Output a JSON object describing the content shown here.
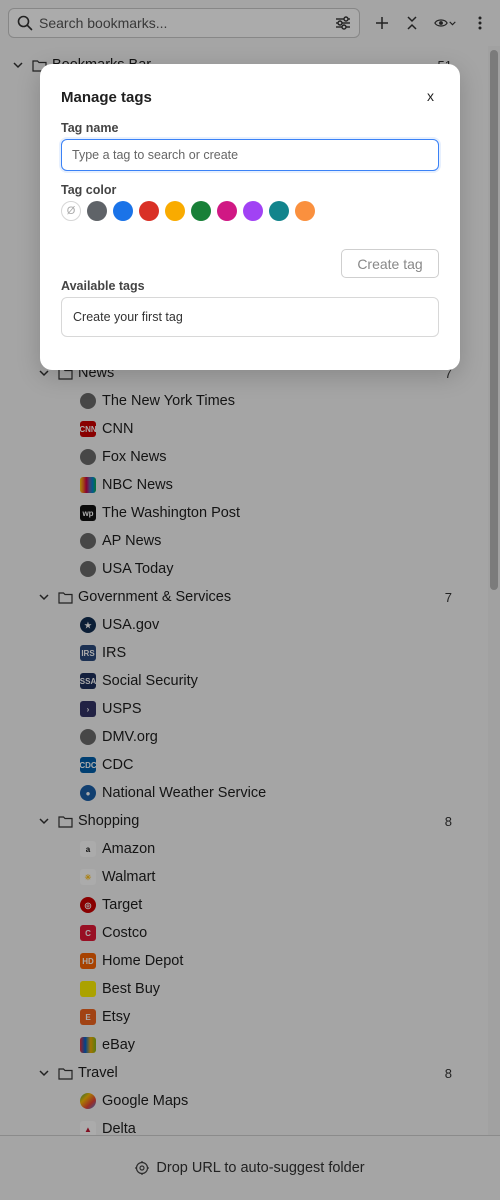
{
  "toolbar": {
    "search_placeholder": "Search bookmarks...",
    "icons": [
      "search-icon",
      "filter-sliders-icon",
      "plus-icon",
      "collapse-icon",
      "eye-icon",
      "chevron-down-icon",
      "more-vertical-icon"
    ]
  },
  "tree": {
    "root": {
      "label": "Bookmarks Bar",
      "count": "51"
    },
    "folders": [
      {
        "label": "News",
        "count": "7",
        "items": [
          {
            "label": "The New York Times",
            "icon": "globe-icon"
          },
          {
            "label": "CNN",
            "icon": "cnn-icon"
          },
          {
            "label": "Fox News",
            "icon": "globe-icon"
          },
          {
            "label": "NBC News",
            "icon": "nbc-peacock-icon"
          },
          {
            "label": "The Washington Post",
            "icon": "wapo-icon"
          },
          {
            "label": "AP News",
            "icon": "globe-icon"
          },
          {
            "label": "USA Today",
            "icon": "globe-icon"
          }
        ]
      },
      {
        "label": "Government & Services",
        "count": "7",
        "items": [
          {
            "label": "USA.gov",
            "icon": "usagov-icon"
          },
          {
            "label": "IRS",
            "icon": "irs-icon"
          },
          {
            "label": "Social Security",
            "icon": "ssa-icon"
          },
          {
            "label": "USPS",
            "icon": "usps-icon"
          },
          {
            "label": "DMV.org",
            "icon": "globe-icon"
          },
          {
            "label": "CDC",
            "icon": "cdc-icon"
          },
          {
            "label": "National Weather Service",
            "icon": "nws-icon"
          }
        ]
      },
      {
        "label": "Shopping",
        "count": "8",
        "items": [
          {
            "label": "Amazon",
            "icon": "amazon-icon"
          },
          {
            "label": "Walmart",
            "icon": "walmart-icon"
          },
          {
            "label": "Target",
            "icon": "target-icon"
          },
          {
            "label": "Costco",
            "icon": "costco-icon"
          },
          {
            "label": "Home Depot",
            "icon": "home-depot-icon"
          },
          {
            "label": "Best Buy",
            "icon": "best-buy-icon"
          },
          {
            "label": "Etsy",
            "icon": "etsy-icon"
          },
          {
            "label": "eBay",
            "icon": "ebay-icon"
          }
        ]
      },
      {
        "label": "Travel",
        "count": "8",
        "items": [
          {
            "label": "Google Maps",
            "icon": "google-maps-icon"
          },
          {
            "label": "Delta",
            "icon": "delta-icon"
          }
        ]
      }
    ]
  },
  "footer": {
    "label": "Drop URL to auto-suggest folder",
    "icon": "target-crosshair-icon"
  },
  "modal": {
    "title": "Manage tags",
    "close_label": "x",
    "tag_name_label": "Tag name",
    "tag_name_placeholder": "Type a tag to search or create",
    "tag_name_value": "",
    "tag_color_label": "Tag color",
    "no_color_glyph": "Ø",
    "colors": [
      "#5f6368",
      "#1a73e8",
      "#d93025",
      "#f9ab00",
      "#188038",
      "#d01884",
      "#a142f4",
      "#12848c",
      "#fa903e"
    ],
    "create_button_label": "Create tag",
    "available_tags_label": "Available tags",
    "available_tags_empty": "Create your first tag"
  }
}
